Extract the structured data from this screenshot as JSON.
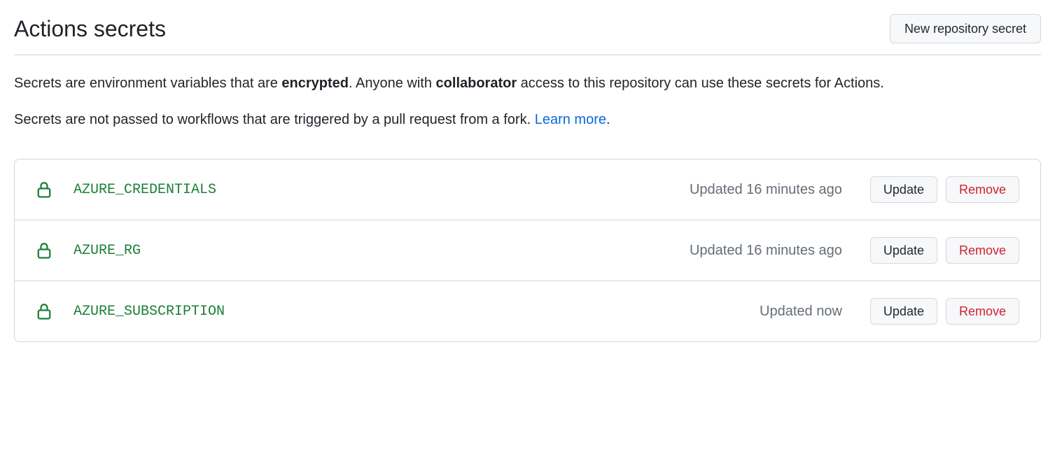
{
  "header": {
    "title": "Actions secrets",
    "new_secret_button": "New repository secret"
  },
  "description": {
    "line1_part1": "Secrets are environment variables that are ",
    "line1_bold1": "encrypted",
    "line1_part2": ". Anyone with ",
    "line1_bold2": "collaborator",
    "line1_part3": " access to this repository can use these secrets for Actions.",
    "line2_part1": "Secrets are not passed to workflows that are triggered by a pull request from a fork. ",
    "line2_link": "Learn more",
    "line2_part2": "."
  },
  "buttons": {
    "update": "Update",
    "remove": "Remove"
  },
  "secrets": [
    {
      "name": "AZURE_CREDENTIALS",
      "updated": "Updated 16 minutes ago"
    },
    {
      "name": "AZURE_RG",
      "updated": "Updated 16 minutes ago"
    },
    {
      "name": "AZURE_SUBSCRIPTION",
      "updated": "Updated now"
    }
  ]
}
